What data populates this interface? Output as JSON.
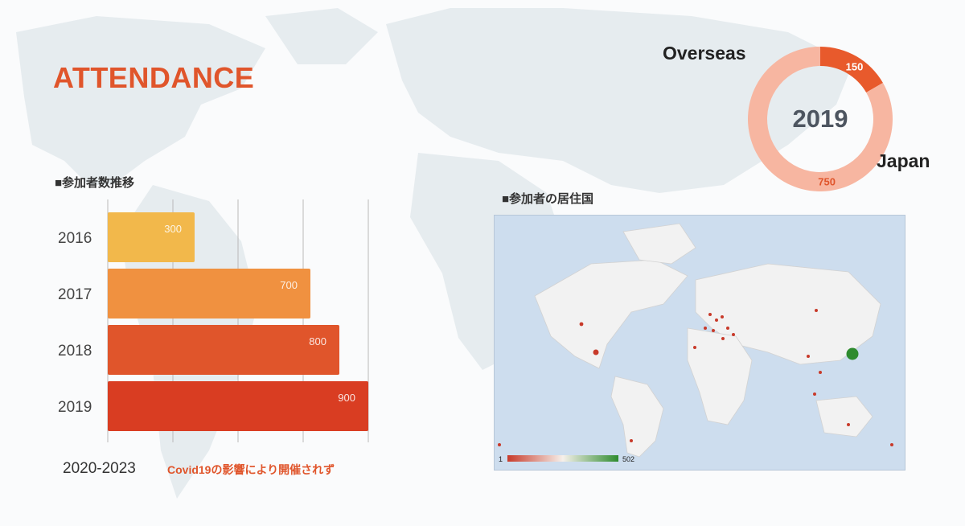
{
  "title": "ATTENDANCE",
  "bar_section_label": "■参加者数推移",
  "map_section_label": "■参加者の居住国",
  "footnote": {
    "year_range": "2020-2023",
    "note": "Covid19の影響により開催されず"
  },
  "colors": {
    "accent": "#e0552b",
    "bar_2016": "#f2b84b",
    "bar_2017": "#f09140",
    "bar_2018": "#e0552b",
    "bar_2019": "#d93d22",
    "donut_japan": "#f7b6a1",
    "donut_overseas": "#e85a2c",
    "map_low": "#c83a2a",
    "map_high": "#2e8b2e"
  },
  "chart_data": [
    {
      "type": "bar",
      "orientation": "horizontal",
      "categories": [
        "2016",
        "2017",
        "2018",
        "2019"
      ],
      "values": [
        300,
        700,
        800,
        900
      ],
      "xlim": [
        0,
        900
      ],
      "grid": true
    },
    {
      "type": "pie",
      "variant": "donut",
      "center_label": "2019",
      "labels": [
        "Overseas",
        "Japan"
      ],
      "values": [
        150,
        750
      ]
    },
    {
      "type": "heatmap",
      "variant": "geo-choropleth",
      "scale_min": "1",
      "scale_max": "502"
    }
  ]
}
